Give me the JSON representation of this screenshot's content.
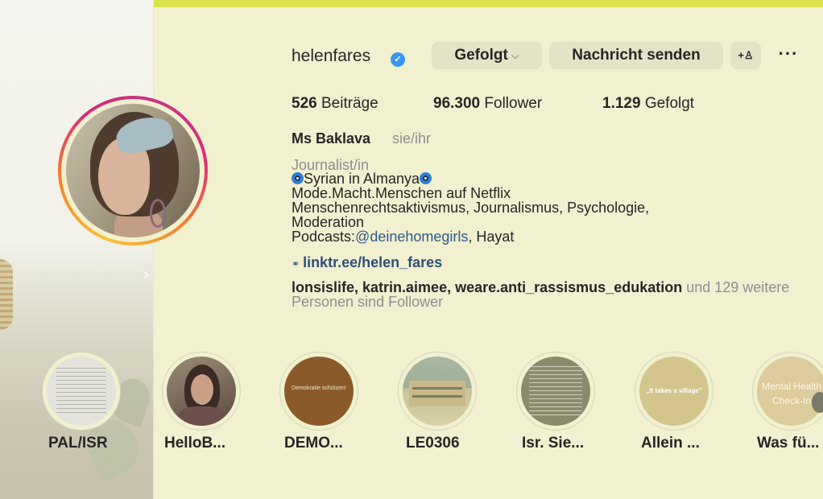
{
  "colors": {
    "background": "#f1f0cf",
    "accent_bar": "#d9e24a",
    "verified": "#3897f0",
    "button": "#e4e3c5"
  },
  "profile": {
    "username": "helenfares",
    "verified_icon": "verified-badge-icon",
    "buttons": {
      "followed": "Gefolgt",
      "message": "Nachricht senden",
      "add_user_icon": "add-user-icon",
      "more_icon": "more-icon"
    },
    "stats": {
      "posts_count": "526",
      "posts_label": "Beiträge",
      "followers_count": "96.300",
      "followers_label": "Follower",
      "following_count": "1.129",
      "following_label": "Gefolgt"
    },
    "full_name": "Ms Baklava",
    "pronouns": "sie/ihr",
    "category": "Journalist/in",
    "bio": {
      "line1": "Syrian in Almanya",
      "line2": "Mode.Macht.Menschen auf Netflix",
      "line3": "Menschenrechtsaktivismus, Journalismus, Psychologie,",
      "line4": "Moderation",
      "line5_prefix": "Podcasts:",
      "line5_mention": "@deinehomegirls",
      "line5_suffix": ", Hayat"
    },
    "link": "linktr.ee/helen_fares",
    "followed_by": {
      "names": "lonsislife, katrin.aimee, weare.anti_rassismus_edukation",
      "rest": " und 129 weitere Personen sind Follower"
    }
  },
  "highlights": [
    {
      "label": "PAL/ISR"
    },
    {
      "label": "HelloB..."
    },
    {
      "label": "DEMO...",
      "cover_text": "Demokratie schützen!"
    },
    {
      "label": "LE0306"
    },
    {
      "label": "Isr. Sie..."
    },
    {
      "label": "Allein ...",
      "cover_text": "„It takes a village\""
    },
    {
      "label": "Was fü...",
      "cover_text_1": "Mental Health",
      "cover_text_2": "Check-In"
    }
  ]
}
